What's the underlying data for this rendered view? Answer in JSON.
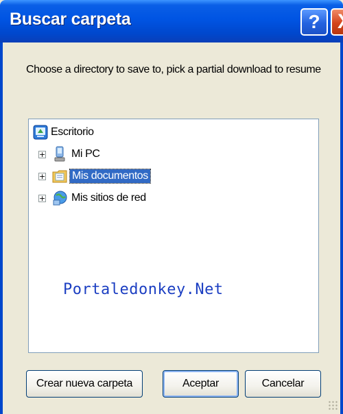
{
  "window": {
    "title": "Buscar carpeta",
    "help_label": "?",
    "close_label": "X"
  },
  "instruction": "Choose a directory to save to, pick a partial download to resume",
  "tree": {
    "root": {
      "label": "Escritorio",
      "icon": "desktop-icon"
    },
    "items": [
      {
        "label": "Mi PC",
        "icon": "computer-icon",
        "expander": "+",
        "selected": false
      },
      {
        "label": "Mis documentos",
        "icon": "folder-documents-icon",
        "expander": "+",
        "selected": true
      },
      {
        "label": "Mis sitios de red",
        "icon": "network-places-icon",
        "expander": "+",
        "selected": false
      }
    ]
  },
  "watermark": "Portaledonkey.Net",
  "buttons": {
    "new_folder": "Crear nueva carpeta",
    "accept": "Aceptar",
    "cancel": "Cancelar"
  }
}
